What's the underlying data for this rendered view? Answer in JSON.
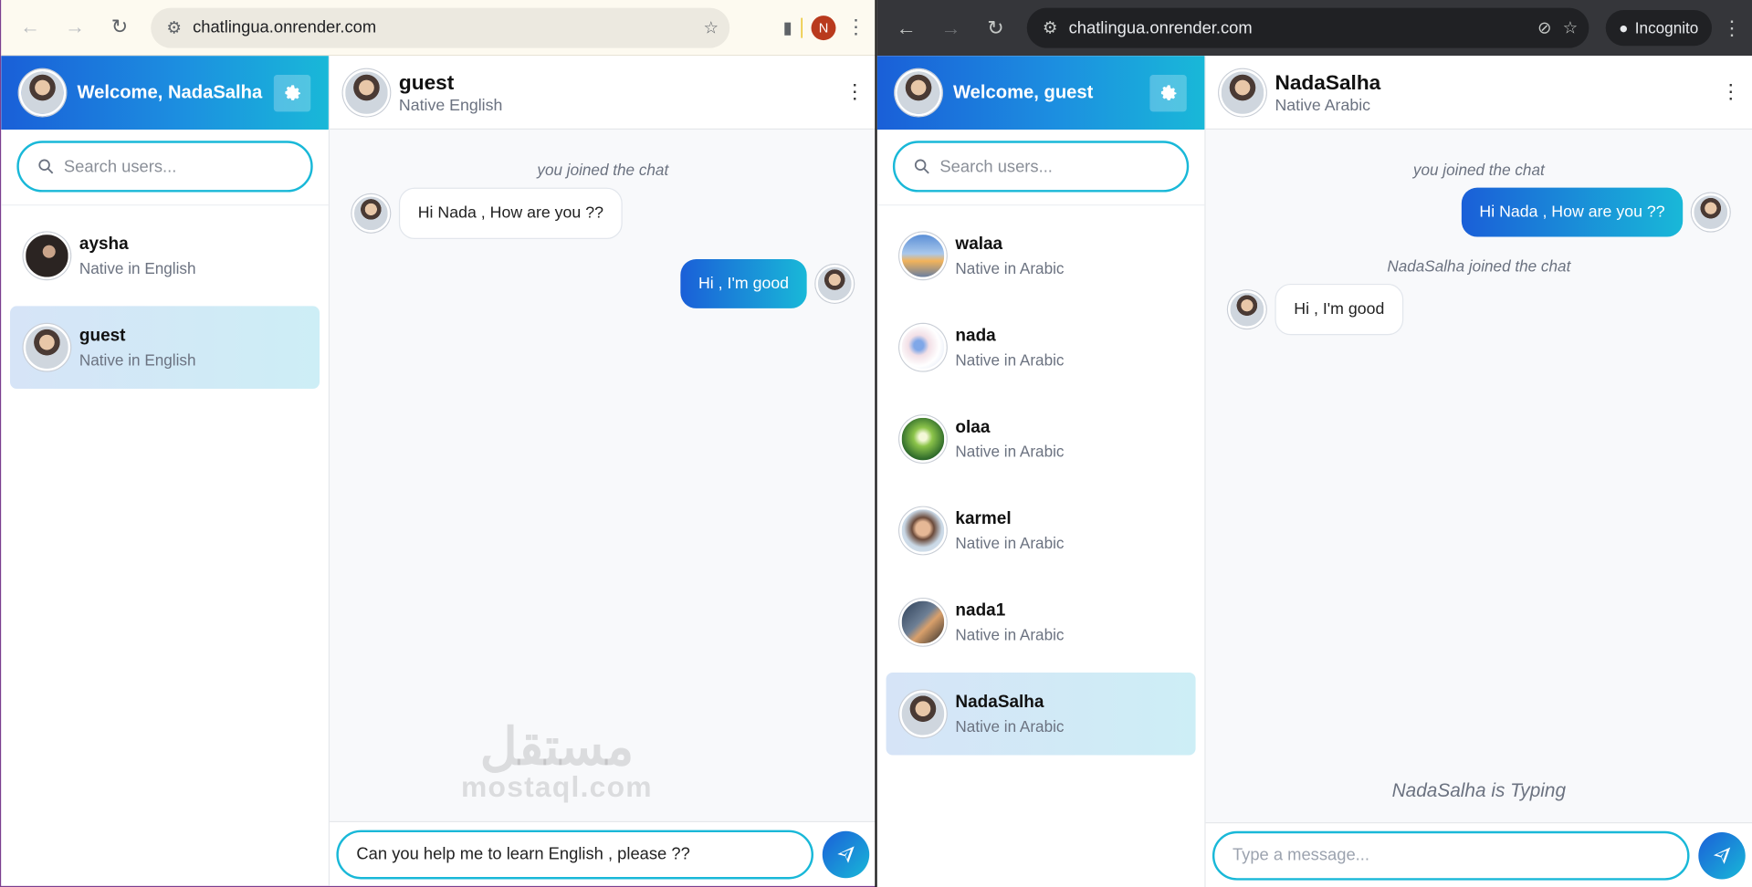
{
  "left_window": {
    "browser": {
      "url": "chatlingua.onrender.com",
      "profile_initial": "N"
    },
    "sidebar": {
      "welcome": "Welcome, NadaSalha",
      "search_placeholder": "Search users...",
      "users": [
        {
          "name": "aysha",
          "lang": "Native in English",
          "avatar": "av-aysha",
          "active": false
        },
        {
          "name": "guest",
          "lang": "Native in English",
          "avatar": "av-self",
          "active": true
        }
      ]
    },
    "chat": {
      "name": "guest",
      "sub": "Native English",
      "system_1": "you joined the chat",
      "msg_in_1": "Hi Nada , How are you ??",
      "msg_out_1": "Hi , I'm good",
      "input_value": "Can you help me to learn English , please ??",
      "watermark_ar": "مستقل",
      "watermark_en": "mostaql.com"
    }
  },
  "right_window": {
    "browser": {
      "url": "chatlingua.onrender.com",
      "incognito_label": "Incognito"
    },
    "sidebar": {
      "welcome": "Welcome, guest",
      "search_placeholder": "Search users...",
      "users": [
        {
          "name": "walaa",
          "lang": "Native in Arabic",
          "avatar": "av-walaa",
          "active": false
        },
        {
          "name": "nada",
          "lang": "Native in Arabic",
          "avatar": "av-nada",
          "active": false
        },
        {
          "name": "olaa",
          "lang": "Native in Arabic",
          "avatar": "av-olaa",
          "active": false
        },
        {
          "name": "karmel",
          "lang": "Native in Arabic",
          "avatar": "av-karmel",
          "active": false
        },
        {
          "name": "nada1",
          "lang": "Native in Arabic",
          "avatar": "av-nada1",
          "active": false
        },
        {
          "name": "NadaSalha",
          "lang": "Native in Arabic",
          "avatar": "av-self",
          "active": true
        }
      ]
    },
    "chat": {
      "name": "NadaSalha",
      "sub": "Native Arabic",
      "system_1": "you joined the chat",
      "msg_out_1": "Hi Nada , How are you ??",
      "system_2": "NadaSalha joined the chat",
      "msg_in_1": "Hi , I'm good",
      "typing": "NadaSalha is Typing",
      "input_placeholder": "Type a message..."
    }
  },
  "colors": {
    "accent_start": "#1a5fd8",
    "accent_end": "#19b8d8",
    "active_row": "#d6e4f7"
  }
}
